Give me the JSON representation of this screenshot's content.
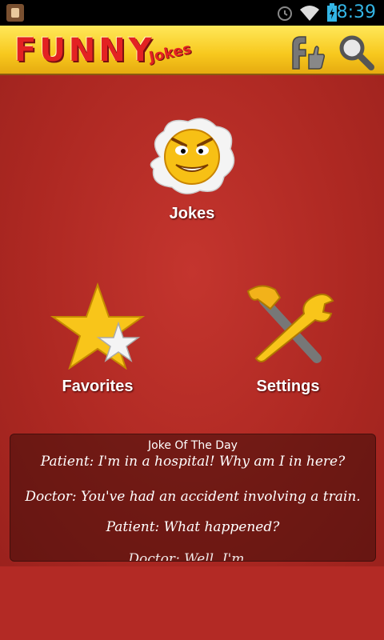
{
  "status": {
    "time": "8:39"
  },
  "header": {
    "logo_main": "FUNNY",
    "logo_sub": "Jokes"
  },
  "menu": {
    "jokes": "Jokes",
    "favorites": "Favorites",
    "settings": "Settings"
  },
  "jotd": {
    "title": "Joke Of The Day",
    "lines": [
      "Patient: I'm in a hospital! Why am I in here?",
      "Doctor: You've had an accident involving a train.",
      "Patient: What happened?",
      "Doctor: Well, I'm..."
    ]
  },
  "colors": {
    "accent": "#33b5e5",
    "header": "#f7c81d",
    "background": "#b32a25"
  }
}
